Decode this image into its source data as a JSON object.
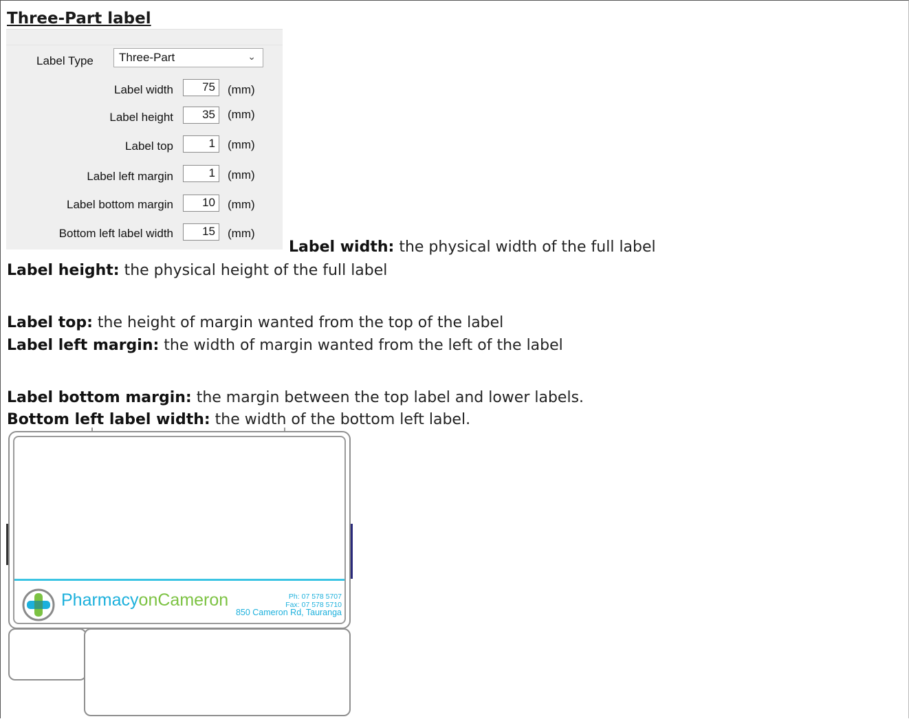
{
  "doc": {
    "title": "Three-Part label"
  },
  "panel": {
    "label_type_label": "Label Type",
    "label_type_value": "Three-Part",
    "rows": [
      {
        "label": "Label width",
        "value": "75",
        "unit": "(mm)"
      },
      {
        "label": "Label height",
        "value": "35",
        "unit": "(mm)"
      },
      {
        "label": "Label top",
        "value": "1",
        "unit": "(mm)"
      },
      {
        "label": "Label left margin",
        "value": "1",
        "unit": "(mm)"
      },
      {
        "label": "Label bottom margin",
        "value": "10",
        "unit": "(mm)"
      },
      {
        "label": "Bottom left label width",
        "value": "15",
        "unit": "(mm)"
      }
    ]
  },
  "descriptions": [
    {
      "term": "Label width:",
      "text": " the physical width of the full label"
    },
    {
      "term": "Label height:",
      "text": " the physical height of the full label"
    },
    {
      "term": "Label top:",
      "text": " the height of margin wanted from the top of the label"
    },
    {
      "term": "Label left margin:",
      "text": " the width of margin wanted from the left of the label"
    },
    {
      "term": "Label bottom margin:",
      "text": " the margin between the top label and lower labels."
    },
    {
      "term": "Bottom left label width:",
      "text": " the width of the bottom left label."
    }
  ],
  "label_preview": {
    "brand_part1": "Pharmacy",
    "brand_part2": "onCameron",
    "phone": "Ph: 07 578 5707",
    "fax": "Fax: 07 578 5710",
    "address": "850 Cameron Rd, Tauranga",
    "colors": {
      "brand_blue": "#1cb0dc",
      "brand_green": "#7cc242",
      "divider": "#3bc4e3"
    }
  }
}
